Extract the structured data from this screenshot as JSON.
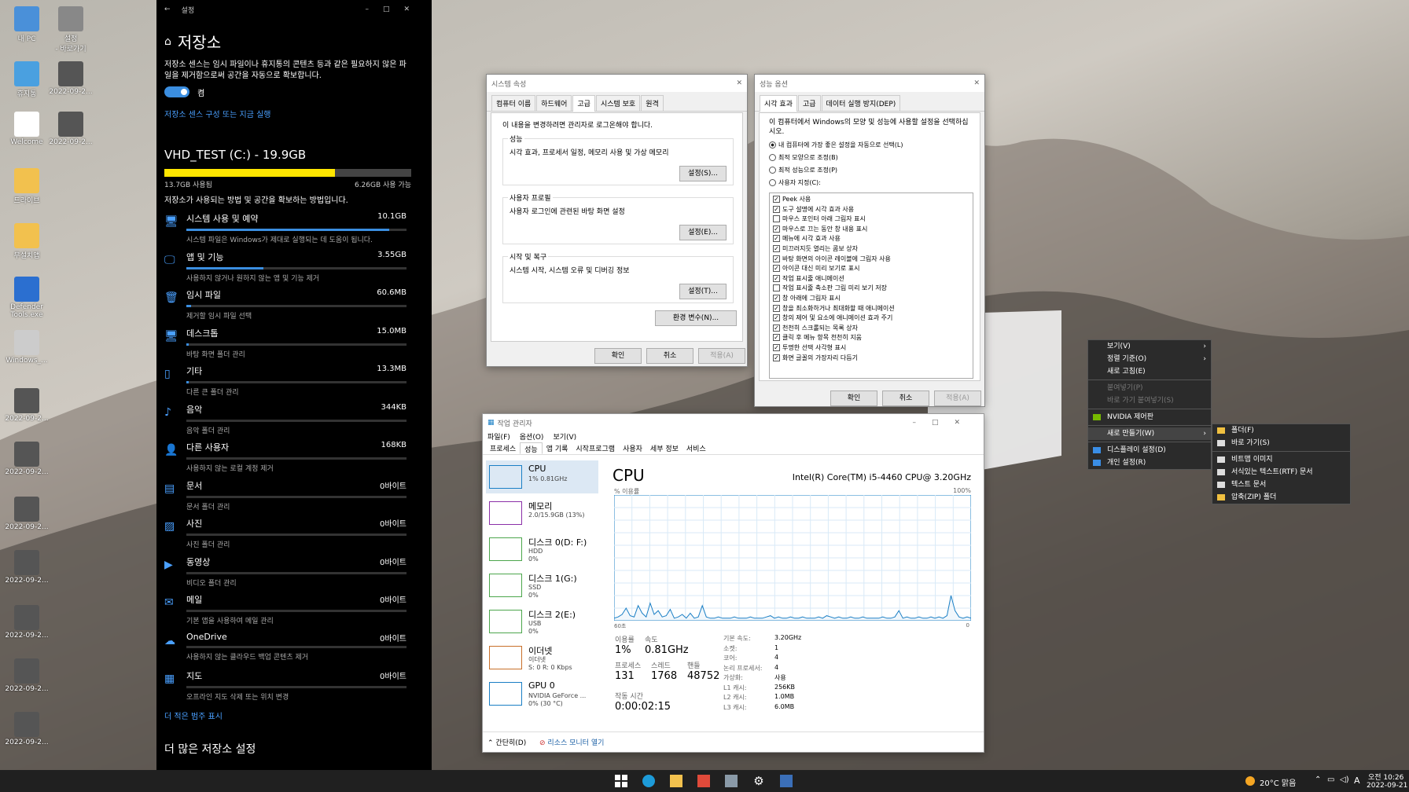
{
  "desktop": {
    "icons": [
      {
        "label": "내 PC",
        "x": 0
      },
      {
        "label": "설정\n- 바로가기",
        "x": 1
      },
      {
        "label": "휴지통",
        "x": 2
      },
      {
        "label": "2022-09-2...",
        "x": 3
      },
      {
        "label": "Welcome",
        "x": 4
      },
      {
        "label": "2022-09-2...",
        "x": 5
      },
      {
        "label": "드라이브",
        "x": 6
      },
      {
        "label": "무설치앱",
        "x": 7
      },
      {
        "label": "Defender Tools.exe",
        "x": 8
      },
      {
        "label": "Windows_...",
        "x": 9
      },
      {
        "label": "2022-09-2..."
      },
      {
        "label": "2022-09-2..."
      },
      {
        "label": "2022-09-2..."
      },
      {
        "label": "2022-09-2..."
      },
      {
        "label": "2022-09-2..."
      },
      {
        "label": "2022-09-2..."
      },
      {
        "label": "2022-09-2..."
      }
    ]
  },
  "settings": {
    "window_title": "설정",
    "page_title": "저장소",
    "intro": "저장소 센스는 임시 파일이나 휴지통의 콘텐츠 등과 같은 필요하지 않은 파일을 제거함으로써 공간을 자동으로 확보합니다.",
    "toggle_label": "켬",
    "toggle_on": true,
    "config_link": "저장소 센스 구성 또는 지금 실행",
    "drive_title": "VHD_TEST (C:) - 19.9GB",
    "used": "13.7GB 사용됨",
    "free": "6.26GB 사용 가능",
    "used_fraction": 0.69,
    "how_text": "저장소가 사용되는 방법 및 공간을 확보하는 방법입니다.",
    "categories": [
      {
        "name": "시스템 사용 및 예약",
        "value": "10.1GB",
        "desc": "시스템 파일은 Windows가 제대로 실행되는 데 도움이 됩니다.",
        "fill": 0.92
      },
      {
        "name": "앱 및 기능",
        "value": "3.55GB",
        "desc": "사용하지 않거나 원하지 않는 앱 및 기능 제거",
        "fill": 0.35
      },
      {
        "name": "임시 파일",
        "value": "60.6MB",
        "desc": "제거할 임시 파일 선택",
        "fill": 0.02
      },
      {
        "name": "데스크톱",
        "value": "15.0MB",
        "desc": "바탕 화면 폴더 관리",
        "fill": 0.01
      },
      {
        "name": "기타",
        "value": "13.3MB",
        "desc": "다른 큰 폴더 관리",
        "fill": 0.01
      },
      {
        "name": "음악",
        "value": "344KB",
        "desc": "음악 폴더 관리",
        "fill": 0
      },
      {
        "name": "다른 사용자",
        "value": "168KB",
        "desc": "사용하지 않는 로컬 계정 제거",
        "fill": 0
      },
      {
        "name": "문서",
        "value": "0바이트",
        "desc": "문서 폴더 관리",
        "fill": 0
      },
      {
        "name": "사진",
        "value": "0바이트",
        "desc": "사진 폴더 관리",
        "fill": 0
      },
      {
        "name": "동영상",
        "value": "0바이트",
        "desc": "비디오 폴더 관리",
        "fill": 0
      },
      {
        "name": "메일",
        "value": "0바이트",
        "desc": "기본 앱을 사용하여 메일 관리",
        "fill": 0
      },
      {
        "name": "OneDrive",
        "value": "0바이트",
        "desc": "사용하지 않는 클라우드 백업 콘텐츠 제거",
        "fill": 0
      },
      {
        "name": "지도",
        "value": "0바이트",
        "desc": "오프라인 지도 삭제 또는 위치 변경",
        "fill": 0
      }
    ],
    "more_link": "더 적은 범주 표시",
    "more_settings": "더 많은 저장소 설정"
  },
  "sysprops": {
    "title": "시스템 속성",
    "tabs": [
      "컴퓨터 이름",
      "하드웨어",
      "고급",
      "시스템 보호",
      "원격"
    ],
    "selected_tab": 2,
    "admin_note": "이 내용을 변경하려면 관리자로 로그온해야 합니다.",
    "groups": [
      {
        "title": "성능",
        "text": "시각 효과, 프로세서 일정, 메모리 사용 및 가상 메모리",
        "button": "설정(S)..."
      },
      {
        "title": "사용자 프로필",
        "text": "사용자 로그인에 관련된 바탕 화면 설정",
        "button": "설정(E)..."
      },
      {
        "title": "시작 및 복구",
        "text": "시스템 시작, 시스템 오류 및 디버깅 정보",
        "button": "설정(T)..."
      }
    ],
    "env_button": "환경 변수(N)...",
    "ok": "확인",
    "cancel": "취소",
    "apply": "적용(A)"
  },
  "perfopts": {
    "title": "성능 옵션",
    "tabs": [
      "시각 효과",
      "고급",
      "데이터 실행 방지(DEP)"
    ],
    "intro": "이 컴퓨터에서 Windows의 모양 및 성능에 사용할 설정을 선택하십시오.",
    "radios": [
      "내 컴퓨터에 가장 좋은 설정을 자동으로 선택(L)",
      "최적 모양으로 조정(B)",
      "최적 성능으로 조정(P)",
      "사용자 지정(C):"
    ],
    "selected_radio": 0,
    "checks": [
      {
        "t": "Peek 사용",
        "c": true
      },
      {
        "t": "도구 설명에 시각 효과 사용",
        "c": true
      },
      {
        "t": "마우스 포인터 아래 그림자 표시",
        "c": false
      },
      {
        "t": "마우스로 끄는 동안 창 내용 표시",
        "c": true
      },
      {
        "t": "메뉴에 시각 효과 사용",
        "c": true
      },
      {
        "t": "미끄러지듯 열리는 콤보 상자",
        "c": true
      },
      {
        "t": "바탕 화면의 아이콘 레이블에 그림자 사용",
        "c": true
      },
      {
        "t": "아이콘 대신 미리 보기로 표시",
        "c": true
      },
      {
        "t": "작업 표시줄 애니메이션",
        "c": true
      },
      {
        "t": "작업 표시줄 축소판 그림 미리 보기 저장",
        "c": false
      },
      {
        "t": "창 아래에 그림자 표시",
        "c": true
      },
      {
        "t": "창을 최소화하거나 최대화할 때 애니메이션",
        "c": true
      },
      {
        "t": "창의 제어 및 요소에 애니메이션 효과 주기",
        "c": true
      },
      {
        "t": "천천히 스크롤되는 목록 상자",
        "c": true
      },
      {
        "t": "클릭 후 메뉴 항목 천천히 지움",
        "c": true
      },
      {
        "t": "투명한 선택 사각형 표시",
        "c": true
      },
      {
        "t": "화면 글꼴의 가장자리 다듬기",
        "c": true
      }
    ],
    "ok": "확인",
    "cancel": "취소",
    "apply": "적용(A)"
  },
  "taskmgr": {
    "title": "작업 관리자",
    "menu": [
      "파일(F)",
      "옵션(O)",
      "보기(V)"
    ],
    "tabs": [
      "프로세스",
      "성능",
      "앱 기록",
      "시작프로그램",
      "사용자",
      "세부 정보",
      "서비스"
    ],
    "selected_tab": 1,
    "sidebar": [
      {
        "t": "CPU",
        "s": "1% 0.81GHz",
        "color": "#1a7fc5"
      },
      {
        "t": "메모리",
        "s": "2.0/15.9GB (13%)",
        "color": "#8b2fa8"
      },
      {
        "t": "디스크 0(D: F:)",
        "s": "HDD\n0%",
        "color": "#4ca64c"
      },
      {
        "t": "디스크 1(G:)",
        "s": "SSD\n0%",
        "color": "#4ca64c"
      },
      {
        "t": "디스크 2(E:)",
        "s": "USB\n0%",
        "color": "#4ca64c"
      },
      {
        "t": "이더넷",
        "s": "이더넷\nS: 0 R: 0 Kbps",
        "color": "#c8702a"
      },
      {
        "t": "GPU 0",
        "s": "NVIDIA GeForce ...\n0% (30 °C)",
        "color": "#1a7fc5"
      }
    ],
    "heading": "CPU",
    "cpu_name": "Intel(R) Core(TM) i5-4460 CPU@ 3.20GHz",
    "util_label": "% 이용률",
    "util_max": "100%",
    "x_left": "60초",
    "x_right": "0",
    "stats": {
      "util_l": "이용률",
      "util": "1%",
      "speed_l": "속도",
      "speed": "0.81GHz",
      "proc_l": "프로세스",
      "proc": "131",
      "thr_l": "스레드",
      "thr": "1768",
      "hnd_l": "핸들",
      "hnd": "48752",
      "up_l": "작동 시간",
      "up": "0:00:02:15"
    },
    "info": [
      [
        "기본 속도:",
        "3.20GHz"
      ],
      [
        "소켓:",
        "1"
      ],
      [
        "코어:",
        "4"
      ],
      [
        "논리 프로세서:",
        "4"
      ],
      [
        "가상화:",
        "사용"
      ],
      [
        "L1 캐시:",
        "256KB"
      ],
      [
        "L2 캐시:",
        "1.0MB"
      ],
      [
        "L3 캐시:",
        "6.0MB"
      ]
    ],
    "footer_less": "간단히(D)",
    "footer_monitor": "리소스 모니터 열기",
    "cpu_series": [
      2,
      3,
      5,
      10,
      4,
      3,
      12,
      6,
      3,
      14,
      5,
      8,
      3,
      4,
      9,
      2,
      3,
      5,
      2,
      6,
      2,
      3,
      12,
      3,
      2,
      2,
      3,
      2,
      2,
      2,
      3,
      2,
      2,
      2,
      3,
      2,
      2,
      2,
      3,
      4,
      2,
      3,
      2,
      2,
      3,
      2,
      2,
      3,
      2,
      2,
      2,
      3,
      2,
      4,
      3,
      2,
      3,
      2,
      2,
      3,
      2,
      2,
      3,
      2,
      2,
      2,
      2,
      3,
      2,
      2,
      3,
      8,
      2,
      3,
      2,
      2,
      3,
      2,
      2,
      3,
      2,
      3,
      2,
      4,
      20,
      8,
      3,
      2,
      3,
      2
    ]
  },
  "context_menu": {
    "items": [
      {
        "t": "보기(V)",
        "arrow": true
      },
      {
        "t": "정렬 기준(O)",
        "arrow": true
      },
      {
        "t": "새로 고침(E)"
      },
      {
        "sep": true
      },
      {
        "t": "붙여넣기(P)",
        "dis": true
      },
      {
        "t": "바로 가기 붙여넣기(S)",
        "dis": true
      },
      {
        "sep": true
      },
      {
        "t": "NVIDIA 제어판",
        "icon": "#76b900"
      },
      {
        "sep": true
      },
      {
        "t": "새로 만들기(W)",
        "arrow": true,
        "hl": true
      },
      {
        "sep": true
      },
      {
        "t": "디스플레이 설정(D)",
        "icon": "#3a8ee6"
      },
      {
        "t": "개인 설정(R)",
        "icon": "#3a8ee6"
      }
    ],
    "submenu": [
      {
        "t": "폴더(F)",
        "icon": "#f0c040"
      },
      {
        "t": "바로 가기(S)",
        "icon": "#ddd"
      },
      {
        "sep": true
      },
      {
        "t": "비트맵 이미지",
        "icon": "#ddd"
      },
      {
        "t": "서식있는 텍스트(RTF) 문서",
        "icon": "#ddd"
      },
      {
        "t": "텍스트 문서",
        "icon": "#ddd"
      },
      {
        "t": "압축(ZIP) 폴더",
        "icon": "#f0c040"
      }
    ]
  },
  "taskbar": {
    "weather": "20°C 맑음",
    "ime": "A",
    "time": "오전 10:26",
    "date": "2022-09-21"
  }
}
